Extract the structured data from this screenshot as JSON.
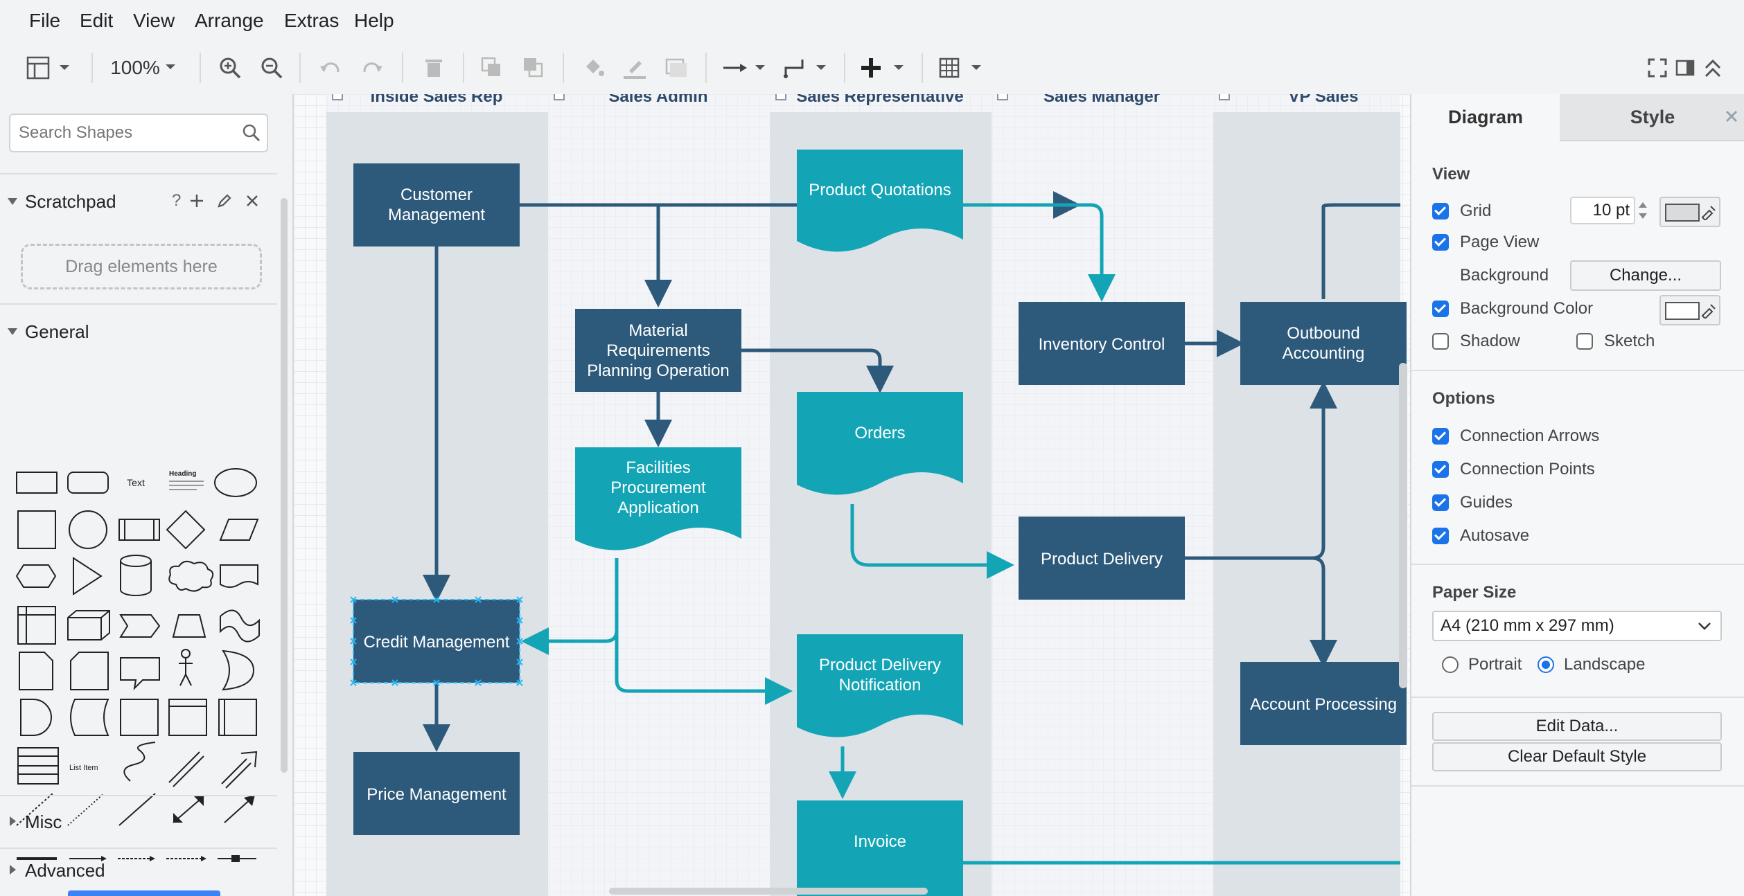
{
  "menubar": {
    "items": [
      "File",
      "Edit",
      "View",
      "Arrange",
      "Extras",
      "Help"
    ]
  },
  "toolbar": {
    "zoom": "100%",
    "icons": [
      "layout-icon",
      "zoom-in-icon",
      "zoom-out-icon",
      "undo-icon",
      "redo-icon",
      "delete-icon",
      "to-front-icon",
      "to-back-icon",
      "fill-color-icon",
      "line-color-icon",
      "shadow-icon",
      "connection-icon",
      "waypoints-icon",
      "insert-icon",
      "table-icon",
      "fullscreen-icon",
      "format-panel-icon",
      "collapse-icon"
    ]
  },
  "sidebar": {
    "search_placeholder": "Search Shapes",
    "scratchpad": {
      "title": "Scratchpad",
      "help": "?",
      "drop_hint": "Drag elements here"
    },
    "general": {
      "title": "General",
      "text_shape": "Text",
      "heading_shape": "Heading",
      "list_item_shape": "List Item"
    },
    "misc": {
      "title": "Misc"
    },
    "advanced": {
      "title": "Advanced"
    }
  },
  "diagram": {
    "lanes": [
      "Inside Sales Rep",
      "Sales Admin",
      "Sales Representative",
      "Sales Manager",
      "VP Sales"
    ],
    "nodes": {
      "customer_mgmt": [
        "Customer",
        "Management"
      ],
      "product_quotations": [
        "Product Quotations"
      ],
      "mrp": [
        "Material",
        "Requirements",
        "Planning Operation"
      ],
      "inventory_control": [
        "Inventory Control"
      ],
      "outbound_accounting": [
        "Outbound",
        "Accounting"
      ],
      "orders": [
        "Orders"
      ],
      "facilities": [
        "Facilities",
        "Procurement",
        "Application"
      ],
      "product_delivery": [
        "Product Delivery"
      ],
      "credit_mgmt": [
        "Credit Management"
      ],
      "pdn": [
        "Product Delivery",
        "Notification"
      ],
      "account_processing": [
        "Account Processing"
      ],
      "price_mgmt": [
        "Price Management"
      ],
      "invoice": [
        "Invoice"
      ]
    },
    "colors": {
      "dark": "#2d5a7b",
      "teal": "#13a5b5",
      "lane": "#dde2e7"
    }
  },
  "format_panel": {
    "tabs": {
      "diagram": "Diagram",
      "style": "Style"
    },
    "view": {
      "title": "View",
      "grid": {
        "label": "Grid",
        "checked": true,
        "size": "10 pt"
      },
      "page_view": {
        "label": "Page View",
        "checked": true
      },
      "background": {
        "label": "Background",
        "button": "Change..."
      },
      "background_color": {
        "label": "Background Color",
        "checked": true
      },
      "shadow": {
        "label": "Shadow",
        "checked": false
      },
      "sketch": {
        "label": "Sketch",
        "checked": false
      }
    },
    "options": {
      "title": "Options",
      "connection_arrows": {
        "label": "Connection Arrows",
        "checked": true
      },
      "connection_points": {
        "label": "Connection Points",
        "checked": true
      },
      "guides": {
        "label": "Guides",
        "checked": true
      },
      "autosave": {
        "label": "Autosave",
        "checked": true
      }
    },
    "paper_size": {
      "title": "Paper Size",
      "selected": "A4 (210 mm x 297 mm)",
      "portrait": "Portrait",
      "landscape": "Landscape",
      "orientation": "landscape"
    },
    "buttons": {
      "edit_data": "Edit Data...",
      "clear_default_style": "Clear Default Style"
    }
  }
}
